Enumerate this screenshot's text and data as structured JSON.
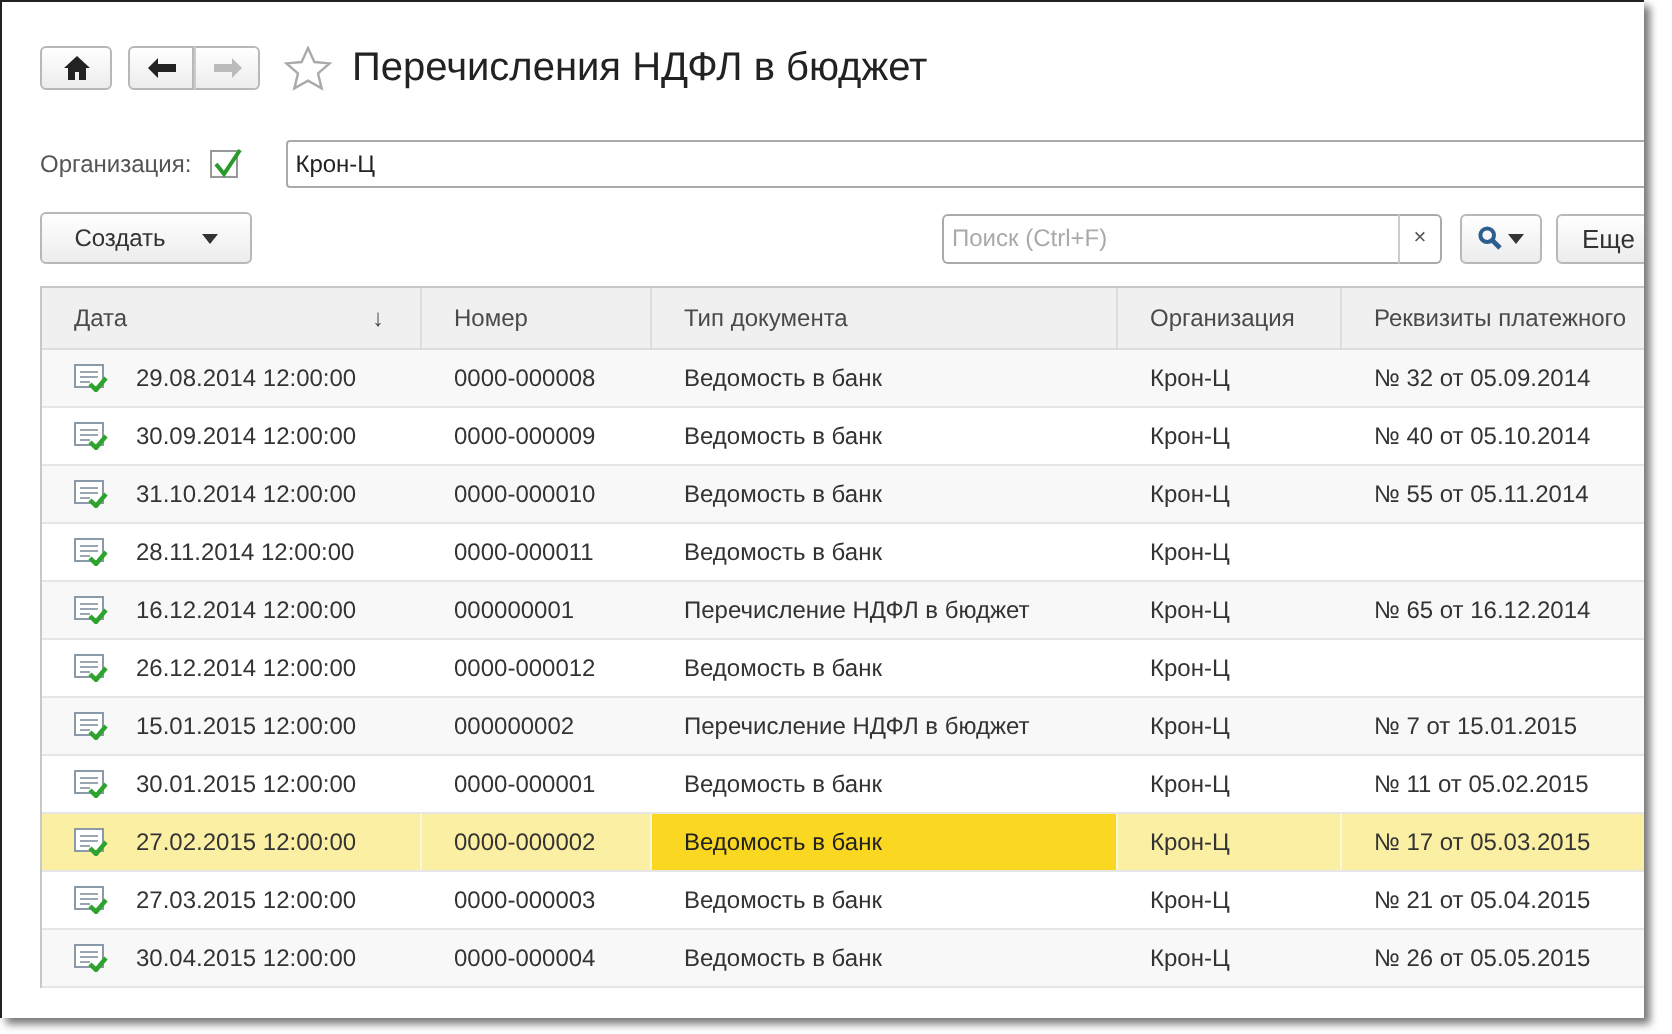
{
  "title": "Перечисления НДФЛ в бюджет",
  "filter": {
    "label": "Организация:",
    "checked": true,
    "value": "Крон-Ц"
  },
  "toolbar": {
    "create_button": "Создать",
    "search": {
      "placeholder": "Поиск (Ctrl+F)",
      "clear": "×"
    },
    "more_button": "Еще"
  },
  "table": {
    "columns": [
      {
        "label": "Дата",
        "sort": "↓",
        "current": false
      },
      {
        "label": "Номер",
        "current": false
      },
      {
        "label": "Тип документа",
        "current": true
      },
      {
        "label": "Организация",
        "current": false
      },
      {
        "label": "Реквизиты платежного",
        "current": false
      }
    ],
    "rows": [
      {
        "cells": [
          "29.08.2014 12:00:00",
          "0000-000008",
          "Ведомость в банк",
          "Крон-Ц",
          "№ 32 от 05.09.2014"
        ],
        "selected": false
      },
      {
        "cells": [
          "30.09.2014 12:00:00",
          "0000-000009",
          "Ведомость в банк",
          "Крон-Ц",
          "№ 40 от 05.10.2014"
        ],
        "selected": false
      },
      {
        "cells": [
          "31.10.2014 12:00:00",
          "0000-000010",
          "Ведомость в банк",
          "Крон-Ц",
          "№ 55 от 05.11.2014"
        ],
        "selected": false
      },
      {
        "cells": [
          "28.11.2014 12:00:00",
          "0000-000011",
          "Ведомость в банк",
          "Крон-Ц"
        ],
        "selected": false
      },
      {
        "cells": [
          "16.12.2014 12:00:00",
          "000000001",
          "Перечисление НДФЛ в бюджет",
          "Крон-Ц",
          "№ 65 от 16.12.2014"
        ],
        "selected": false
      },
      {
        "cells": [
          "26.12.2014 12:00:00",
          "0000-000012",
          "Ведомость в банк",
          "Крон-Ц"
        ],
        "selected": false
      },
      {
        "cells": [
          "15.01.2015 12:00:00",
          "000000002",
          "Перечисление НДФЛ в бюджет",
          "Крон-Ц",
          "№ 7 от 15.01.2015"
        ],
        "selected": false
      },
      {
        "cells": [
          "30.01.2015 12:00:00",
          "0000-000001",
          "Ведомость в банк",
          "Крон-Ц",
          "№ 11 от 05.02.2015"
        ],
        "selected": false
      },
      {
        "cells": [
          "27.02.2015 12:00:00",
          "0000-000002",
          "Ведомость в банк",
          "Крон-Ц",
          "№ 17 от 05.03.2015"
        ],
        "selected": true
      },
      {
        "cells": [
          "27.03.2015 12:00:00",
          "0000-000003",
          "Ведомость в банк",
          "Крон-Ц",
          "№ 21 от 05.04.2015"
        ],
        "selected": false
      },
      {
        "cells": [
          "30.04.2015 12:00:00",
          "0000-000004",
          "Ведомость в банк",
          "Крон-Ц",
          "№ 26 от 05.05.2015"
        ],
        "selected": false
      }
    ]
  }
}
